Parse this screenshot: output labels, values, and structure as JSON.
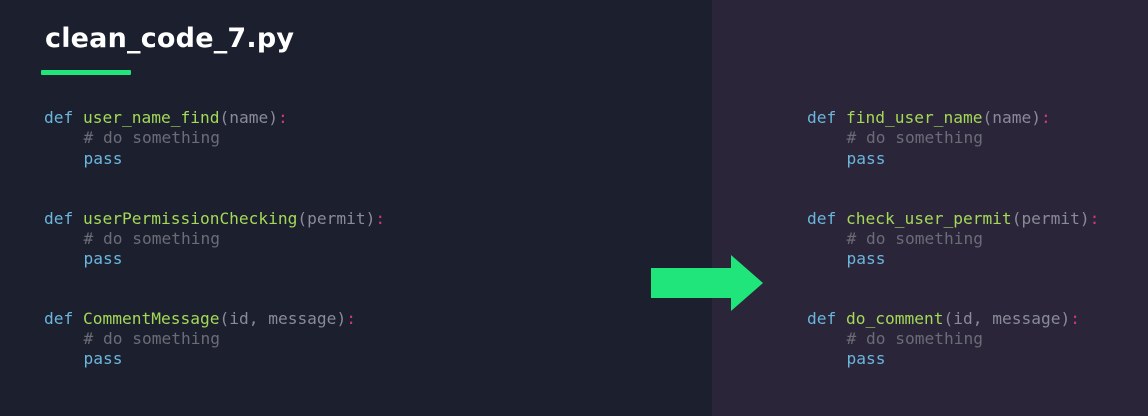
{
  "title": "clean_code_7.py",
  "colors": {
    "left_background": "#1b1f2e",
    "right_background": "#2a2539",
    "accent_green": "#1fe57a",
    "keyword": "#6bb6dd",
    "function_name": "#a4d957",
    "parameter": "#8a8a99",
    "colon": "#d2377a",
    "comment": "#6c6c78"
  },
  "arrow_icon": "arrow-right-icon",
  "before": [
    {
      "keyword": "def",
      "name": "user_name_find",
      "open_paren": "(",
      "params": [
        "name"
      ],
      "close_paren": ")",
      "colon": ":",
      "comment": "# do something",
      "body": "pass"
    },
    {
      "keyword": "def",
      "name": "userPermissionChecking",
      "open_paren": "(",
      "params": [
        "permit"
      ],
      "close_paren": ")",
      "colon": ":",
      "comment": "# do something",
      "body": "pass"
    },
    {
      "keyword": "def",
      "name": "CommentMessage",
      "open_paren": "(",
      "params": [
        "id",
        "message"
      ],
      "close_paren": ")",
      "colon": ":",
      "comment": "# do something",
      "body": "pass"
    }
  ],
  "after": [
    {
      "keyword": "def",
      "name": "find_user_name",
      "open_paren": "(",
      "params": [
        "name"
      ],
      "close_paren": ")",
      "colon": ":",
      "comment": "# do something",
      "body": "pass"
    },
    {
      "keyword": "def",
      "name": "check_user_permit",
      "open_paren": "(",
      "params": [
        "permit"
      ],
      "close_paren": ")",
      "colon": ":",
      "comment": "# do something",
      "body": "pass"
    },
    {
      "keyword": "def",
      "name": "do_comment",
      "open_paren": "(",
      "params": [
        "id",
        "message"
      ],
      "close_paren": ")",
      "colon": ":",
      "comment": "# do something",
      "body": "pass"
    }
  ]
}
